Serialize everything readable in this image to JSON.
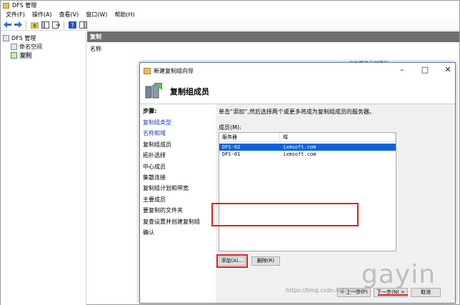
{
  "window": {
    "title": "DFS 管理"
  },
  "menu": [
    "文件(F)",
    "操作(A)",
    "查看(V)",
    "窗口(W)",
    "帮助(H)"
  ],
  "toolbar": {
    "icons": [
      "back-arrow-icon",
      "forward-arrow-icon",
      "up-folder-icon",
      "show-tree-icon",
      "export-icon",
      "help-icon",
      "panel-icon"
    ]
  },
  "tree": {
    "root": "DFS 管理",
    "items": [
      "命名空间",
      "复制"
    ]
  },
  "pane": {
    "header": "复制",
    "column_name": "名称",
    "hint": "没有要显示的项目"
  },
  "dialog": {
    "title": "新建复制组向导",
    "banner_title": "复制组成员",
    "steps_label": "步骤:",
    "steps": [
      {
        "label": "复制组类型",
        "state": "done"
      },
      {
        "label": "名称和域",
        "state": "done"
      },
      {
        "label": "复制组成员",
        "state": "current"
      },
      {
        "label": "拓扑选择",
        "state": "pending"
      },
      {
        "label": "中心成员",
        "state": "pending"
      },
      {
        "label": "集散连接",
        "state": "pending"
      },
      {
        "label": "复制组计划和带宽",
        "state": "pending"
      },
      {
        "label": "主要成员",
        "state": "pending"
      },
      {
        "label": "要复制的文件夹",
        "state": "pending"
      },
      {
        "label": "复查设置并创建复制组",
        "state": "pending"
      },
      {
        "label": "确认",
        "state": "pending"
      }
    ],
    "instruction": "单击“添加”,然后选择两个或更多将成为复制组成员的服务器。",
    "members_label": "成员(M):",
    "columns": [
      "服务器",
      "域"
    ],
    "rows": [
      {
        "server": "DFS-02",
        "domain": "ixmsoft.com",
        "selected": true
      },
      {
        "server": "DFS-01",
        "domain": "ixmsoft.com",
        "selected": false
      }
    ],
    "add_button": "添加(A)...",
    "delete_button": "删除(R)",
    "back_button": "< 上一步(P)",
    "next_button": "下一步(N) >",
    "cancel_button": "取消"
  },
  "watermark": {
    "big": "gayin",
    "url": "https://blog.csdn.net/xianyu"
  },
  "colors": {
    "selection": "#0a64d8",
    "highlight": "#e02020",
    "link": "#1a3fb8",
    "pane_header": "#6f6f6f"
  }
}
